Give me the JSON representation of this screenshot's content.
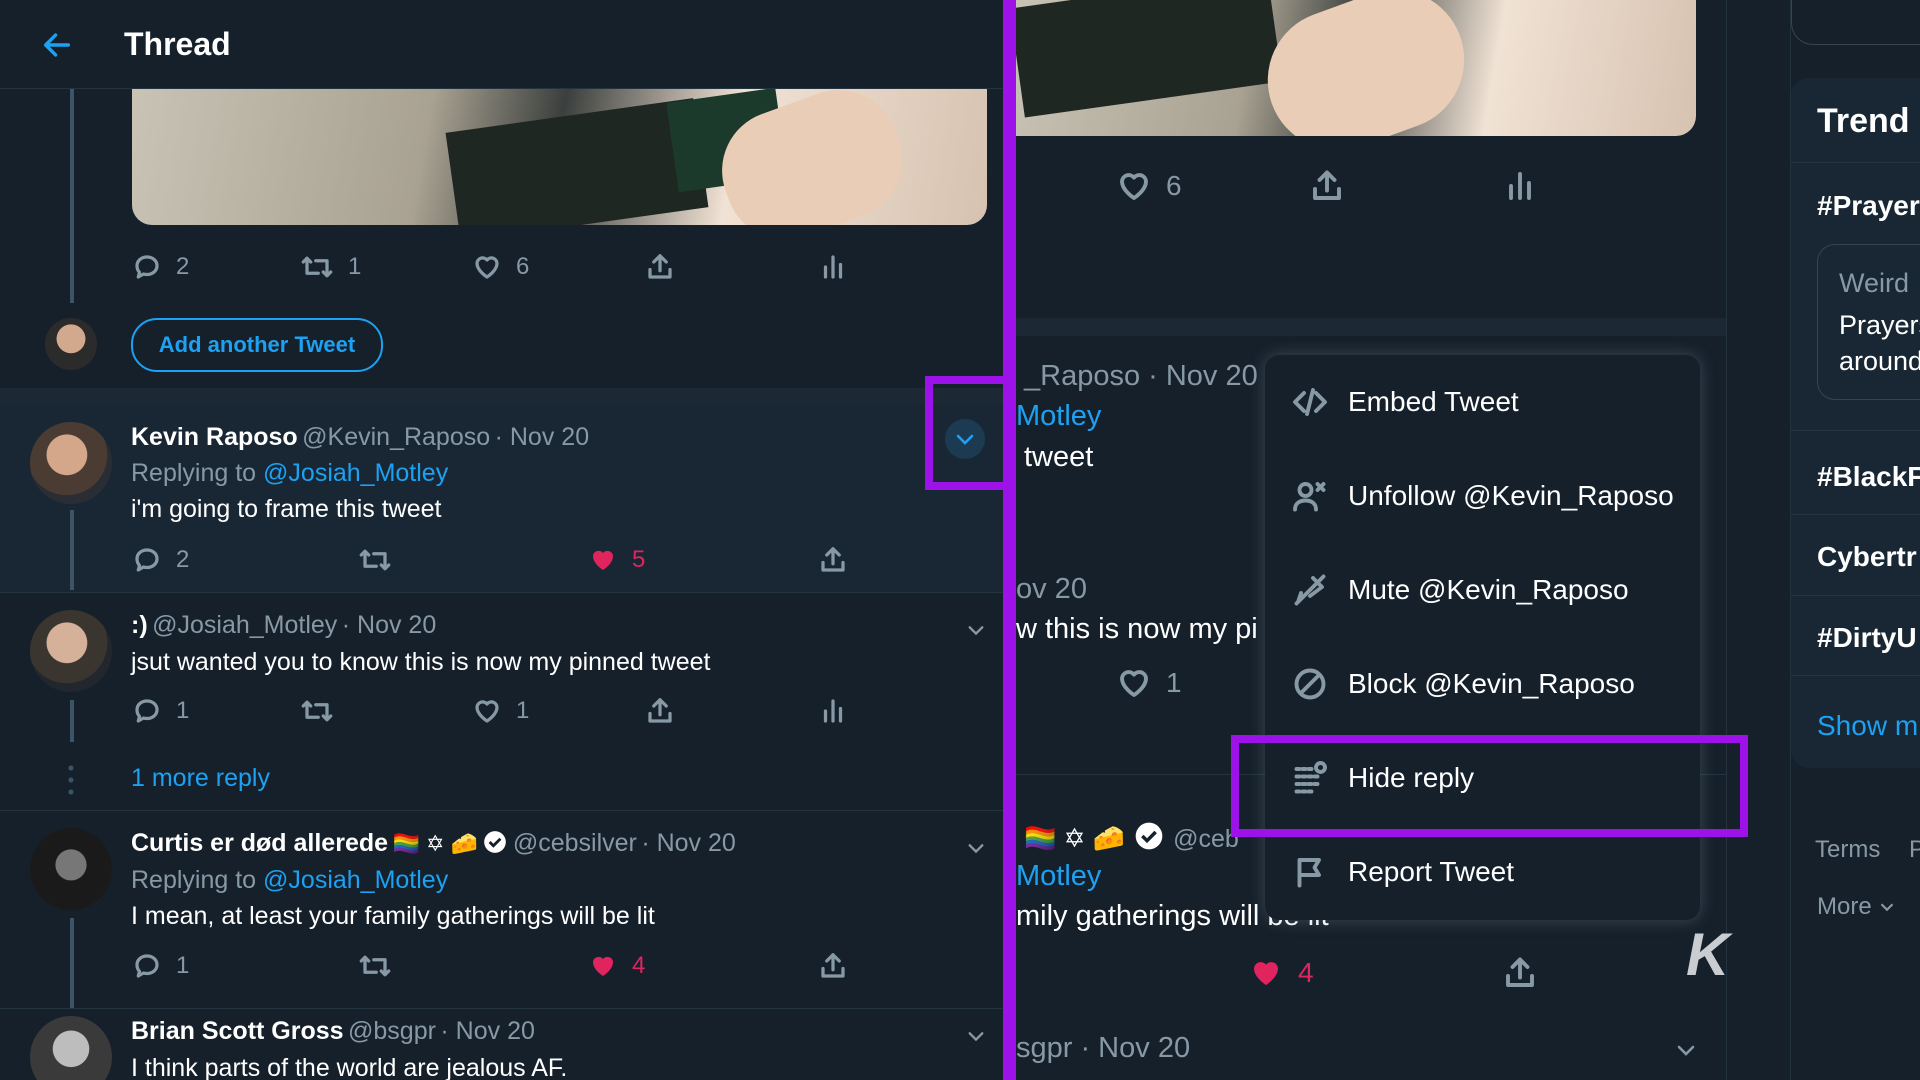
{
  "header": {
    "title": "Thread"
  },
  "top_tweet": {
    "reply_count": "2",
    "retweet_count": "1",
    "like_count": "6"
  },
  "compose": {
    "add_tweet_label": "Add another Tweet"
  },
  "replies": [
    {
      "name": "Kevin Raposo",
      "handle": "@Kevin_Raposo",
      "date": "· Nov 20",
      "replying_prefix": "Replying to",
      "replying_to": "@Josiah_Motley",
      "text": "i'm going to frame this tweet",
      "reply_count": "2",
      "like_count": "5"
    },
    {
      "name": ":)",
      "handle": "@Josiah_Motley",
      "date": "· Nov 20",
      "text": "jsut wanted you to know this is now my pinned tweet",
      "reply_count": "1",
      "like_count": "1",
      "more_reply": "1 more reply"
    },
    {
      "name": "Curtis er død allerede",
      "emojis": "🏳️‍🌈 ✡ 🧀",
      "handle": "@cebsilver",
      "date": "· Nov 20",
      "replying_prefix": "Replying to",
      "replying_to": "@Josiah_Motley",
      "text": "I mean, at least your family gatherings will be lit",
      "reply_count": "1",
      "like_count": "4"
    },
    {
      "name": "Brian Scott Gross",
      "handle": "@bsgpr",
      "date": "· Nov 20",
      "text": "I think parts of the world are jealous AF."
    }
  ],
  "right_panel": {
    "top_like_count": "6",
    "bg_handle_1": "_Raposo · Nov 20",
    "bg_reply_1": "Motley",
    "bg_text_1": "tweet",
    "bg_date_2": "ov 20",
    "bg_text_2": "w this is now my pi",
    "bg_like_2": "1",
    "bg_handle_3": "@ceb",
    "bg_reply_3": "Motley",
    "bg_text_3": "mily gatherings will be lit",
    "bg_like_3": "4",
    "bg_handle_4": "sgpr · Nov 20"
  },
  "menu": {
    "items": [
      {
        "label": "Embed Tweet",
        "icon": "code-icon"
      },
      {
        "label": "Unfollow @Kevin_Raposo",
        "icon": "unfollow-icon"
      },
      {
        "label": "Mute @Kevin_Raposo",
        "icon": "mute-icon"
      },
      {
        "label": "Block @Kevin_Raposo",
        "icon": "block-icon"
      },
      {
        "label": "Hide reply",
        "icon": "hide-reply-icon"
      },
      {
        "label": "Report Tweet",
        "icon": "flag-icon"
      }
    ]
  },
  "sidebar": {
    "title": "Trend",
    "trend_1": "#Prayer",
    "card_line_1": "Weird",
    "card_line_2": "Prayers",
    "card_line_3": "around",
    "trend_2": "#BlackF",
    "trend_3": "Cybertr",
    "trend_4": "#DirtyU",
    "show_more": "Show m",
    "terms": "Terms",
    "p": "P",
    "more": "More"
  },
  "watermark": "K",
  "colors": {
    "accent": "#1da1f2",
    "like": "#e0245e",
    "highlight": "#9d12e8",
    "background": "#15202b"
  }
}
